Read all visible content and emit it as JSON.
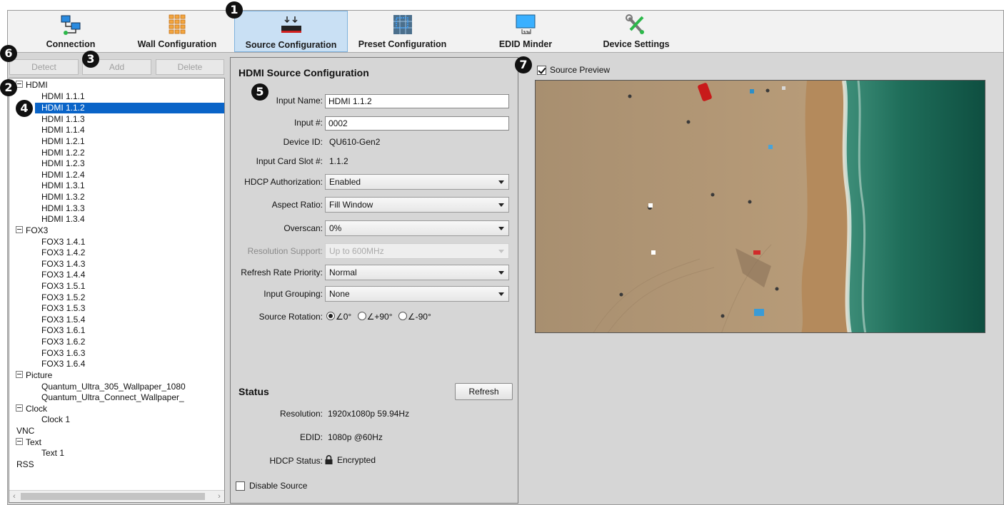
{
  "toolbar": {
    "tabs": [
      {
        "label": "Connection",
        "icon": "connection-icon"
      },
      {
        "label": "Wall Configuration",
        "icon": "wall-grid-icon"
      },
      {
        "label": "Source Configuration",
        "icon": "source-device-icon",
        "active": true
      },
      {
        "label": "Preset Configuration",
        "icon": "preset-grid-icon"
      },
      {
        "label": "EDID Minder",
        "icon": "monitor-icon"
      },
      {
        "label": "Device Settings",
        "icon": "tools-icon"
      }
    ]
  },
  "source_buttons": {
    "detect": "Detect",
    "add": "Add",
    "delete": "Delete"
  },
  "tree": {
    "hdmi": {
      "label": "HDMI",
      "items": [
        "HDMI 1.1.1",
        "HDMI 1.1.2",
        "HDMI 1.1.3",
        "HDMI 1.1.4",
        "HDMI 1.2.1",
        "HDMI 1.2.2",
        "HDMI 1.2.3",
        "HDMI 1.2.4",
        "HDMI 1.3.1",
        "HDMI 1.3.2",
        "HDMI 1.3.3",
        "HDMI 1.3.4"
      ]
    },
    "fox3": {
      "label": "FOX3",
      "items": [
        "FOX3 1.4.1",
        "FOX3 1.4.2",
        "FOX3 1.4.3",
        "FOX3 1.4.4",
        "FOX3 1.5.1",
        "FOX3 1.5.2",
        "FOX3 1.5.3",
        "FOX3 1.5.4",
        "FOX3 1.6.1",
        "FOX3 1.6.2",
        "FOX3 1.6.3",
        "FOX3 1.6.4"
      ]
    },
    "picture": {
      "label": "Picture",
      "items": [
        "Quantum_Ultra_305_Wallpaper_1080",
        "Quantum_Ultra_Connect_Wallpaper_"
      ]
    },
    "clock": {
      "label": "Clock",
      "items": [
        "Clock 1"
      ]
    },
    "vnc": {
      "label": "VNC"
    },
    "text": {
      "label": "Text",
      "items": [
        "Text 1"
      ]
    },
    "rss": {
      "label": "RSS"
    },
    "selected": "HDMI 1.1.2"
  },
  "config": {
    "title": "HDMI Source Configuration",
    "input_name_label": "Input Name:",
    "input_name_value": "HDMI 1.1.2",
    "input_num_label": "Input #:",
    "input_num_value": "0002",
    "device_id_label": "Device ID:",
    "device_id_value": "QU610-Gen2",
    "card_slot_label": "Input Card Slot #:",
    "card_slot_value": "1.1.2",
    "hdcp_auth_label": "HDCP Authorization:",
    "hdcp_auth_value": "Enabled",
    "aspect_label": "Aspect Ratio:",
    "aspect_value": "Fill Window",
    "overscan_label": "Overscan:",
    "overscan_value": "0%",
    "res_support_label": "Resolution Support:",
    "res_support_value": "Up to 600MHz",
    "refresh_priority_label": "Refresh Rate Priority:",
    "refresh_priority_value": "Normal",
    "grouping_label": "Input Grouping:",
    "grouping_value": "None",
    "rotation_label": "Source Rotation:",
    "rotation_options": [
      "∠0°",
      "∠+90°",
      "∠-90°"
    ],
    "rotation_selected": "∠0°"
  },
  "status": {
    "title": "Status",
    "refresh_label": "Refresh",
    "resolution_label": "Resolution:",
    "resolution_value": "1920x1080p 59.94Hz",
    "edid_label": "EDID:",
    "edid_value": "1080p @60Hz",
    "hdcp_label": "HDCP Status:",
    "hdcp_value": "Encrypted",
    "disable_label": "Disable Source",
    "disable_checked": false
  },
  "preview": {
    "label": "Source Preview",
    "checked": true
  },
  "callouts": [
    "1",
    "2",
    "3",
    "4",
    "5",
    "6",
    "7"
  ],
  "colors": {
    "accent": "#0a64c8",
    "active_tab": "#c9e0f4",
    "panel": "#d6d6d6"
  }
}
